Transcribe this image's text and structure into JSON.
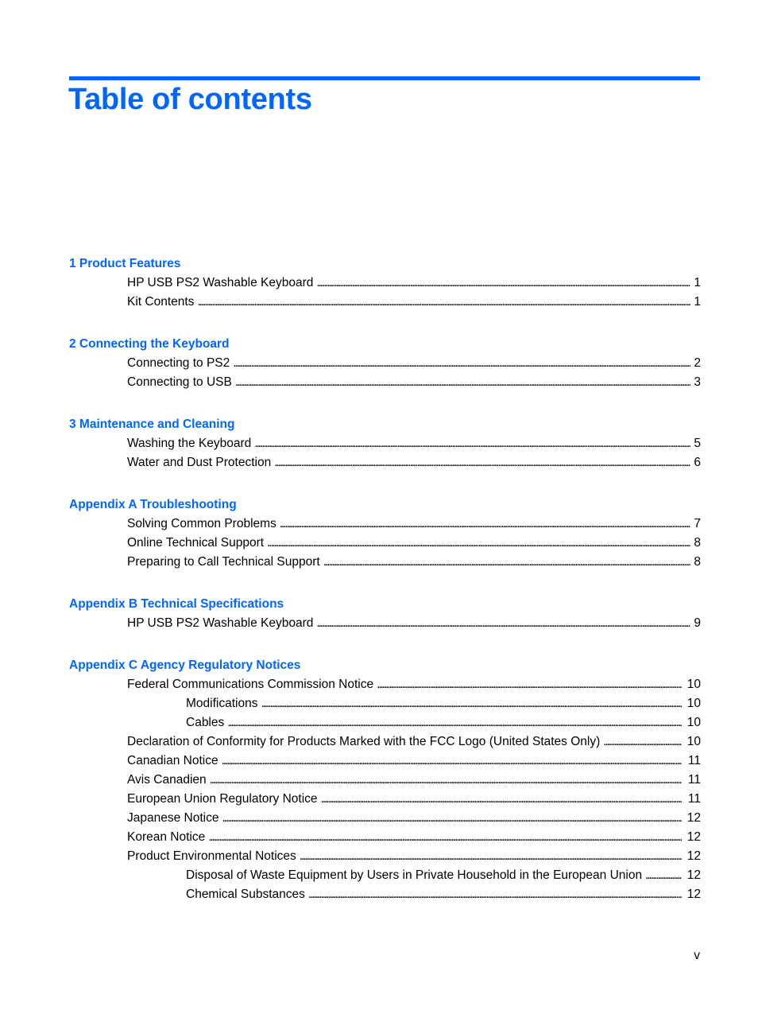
{
  "page": {
    "title": "Table of contents",
    "page_number": "v",
    "accent_color": "#0066ff"
  },
  "sections": [
    {
      "heading": "1  Product Features",
      "entries": [
        {
          "label": "HP USB PS2 Washable Keyboard",
          "page": "1",
          "level": 1
        },
        {
          "label": "Kit Contents",
          "page": "1",
          "level": 1
        }
      ]
    },
    {
      "heading": "2  Connecting the Keyboard",
      "entries": [
        {
          "label": "Connecting to PS2",
          "page": "2",
          "level": 1
        },
        {
          "label": "Connecting to USB",
          "page": "3",
          "level": 1
        }
      ]
    },
    {
      "heading": "3  Maintenance and Cleaning",
      "entries": [
        {
          "label": "Washing the Keyboard",
          "page": "5",
          "level": 1
        },
        {
          "label": "Water and Dust Protection",
          "page": "6",
          "level": 1
        }
      ]
    },
    {
      "heading": "Appendix A  Troubleshooting",
      "entries": [
        {
          "label": "Solving Common Problems",
          "page": "7",
          "level": 1
        },
        {
          "label": "Online Technical Support",
          "page": "8",
          "level": 1
        },
        {
          "label": "Preparing to Call Technical Support",
          "page": "8",
          "level": 1
        }
      ]
    },
    {
      "heading": "Appendix B  Technical Specifications",
      "entries": [
        {
          "label": "HP USB PS2 Washable Keyboard",
          "page": "9",
          "level": 1
        }
      ]
    },
    {
      "heading": "Appendix C  Agency Regulatory Notices",
      "entries": [
        {
          "label": "Federal Communications Commission Notice",
          "page": "10",
          "level": 1
        },
        {
          "label": "Modifications",
          "page": "10",
          "level": 2
        },
        {
          "label": "Cables",
          "page": "10",
          "level": 2
        },
        {
          "label": "Declaration of Conformity for Products Marked with the FCC Logo (United States Only)",
          "page": "10",
          "level": 1
        },
        {
          "label": "Canadian Notice",
          "page": "11",
          "level": 1
        },
        {
          "label": "Avis Canadien",
          "page": "11",
          "level": 1
        },
        {
          "label": "European Union Regulatory Notice",
          "page": "11",
          "level": 1
        },
        {
          "label": "Japanese Notice",
          "page": "12",
          "level": 1
        },
        {
          "label": "Korean Notice",
          "page": "12",
          "level": 1
        },
        {
          "label": "Product Environmental Notices",
          "page": "12",
          "level": 1
        },
        {
          "label": "Disposal of Waste Equipment by Users in Private Household in the European Union",
          "page": "12",
          "level": 2
        },
        {
          "label": "Chemical Substances",
          "page": "12",
          "level": 2
        }
      ]
    }
  ]
}
